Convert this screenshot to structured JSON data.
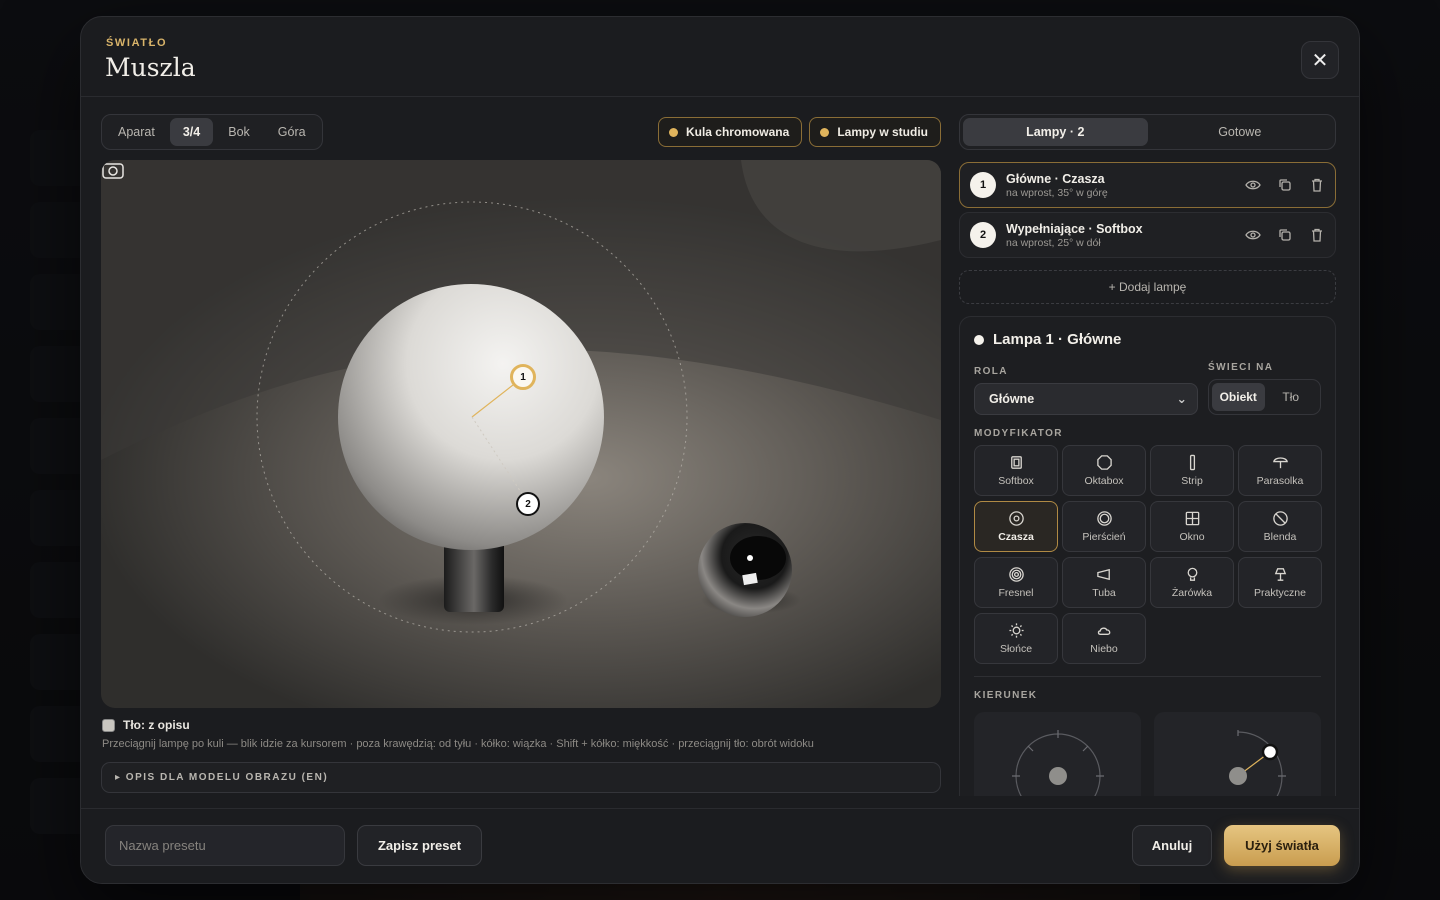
{
  "colors": {
    "accent": "#e0b45c",
    "accent_border": "#8a6d36",
    "panel": "#1b1c1f"
  },
  "modal": {
    "eyebrow": "ŚWIATŁO",
    "title": "Muszla",
    "close_icon": "close-icon"
  },
  "view": {
    "tabs": [
      "Aparat",
      "3/4",
      "Bok",
      "Góra"
    ],
    "active_tab": "3/4",
    "chips": [
      "Kula chromowana",
      "Lampy w studiu"
    ],
    "markers": [
      "1",
      "2"
    ],
    "background_checkbox": "Tło: z opisu",
    "hint": "Przeciągnij lampę po kuli — blik idzie za kursorem · poza krawędzią: od tyłu · kółko: wiązka · Shift + kółko: miękkość · przeciągnij tło: obrót widoku",
    "description_toggle": "▸ OPIS DLA MODELU OBRAZU (EN)"
  },
  "lamps": {
    "tabs": [
      "Lampy · 2",
      "Gotowe"
    ],
    "list": [
      {
        "num": "1",
        "name": "Główne · Czasza",
        "sub": "na wprost, 35° w górę",
        "selected": true
      },
      {
        "num": "2",
        "name": "Wypełniające · Softbox",
        "sub": "na wprost, 25° w dół",
        "selected": false
      }
    ],
    "add_label": "+ Dodaj lampę"
  },
  "editor": {
    "title": "Lampa 1 · Główne",
    "role_label": "ROLA",
    "role_value": "Główne",
    "shine_label": "ŚWIECI NA",
    "shine_options": [
      "Obiekt",
      "Tło"
    ],
    "shine_selected": "Obiekt",
    "modifier_label": "MODYFIKATOR",
    "modifiers": [
      {
        "label": "Softbox",
        "icon": "softbox-icon"
      },
      {
        "label": "Oktabox",
        "icon": "octabox-icon"
      },
      {
        "label": "Strip",
        "icon": "strip-icon"
      },
      {
        "label": "Parasolka",
        "icon": "umbrella-icon"
      },
      {
        "label": "Czasza",
        "icon": "beauty-dish-icon"
      },
      {
        "label": "Pierścień",
        "icon": "ring-light-icon"
      },
      {
        "label": "Okno",
        "icon": "window-icon"
      },
      {
        "label": "Blenda",
        "icon": "flag-icon"
      },
      {
        "label": "Fresnel",
        "icon": "fresnel-icon"
      },
      {
        "label": "Tuba",
        "icon": "snoot-icon"
      },
      {
        "label": "Żarówka",
        "icon": "bulb-icon"
      },
      {
        "label": "Praktyczne",
        "icon": "practical-lamp-icon"
      },
      {
        "label": "Słońce",
        "icon": "sun-icon"
      },
      {
        "label": "Niebo",
        "icon": "cloud-icon"
      }
    ],
    "modifier_selected": "Czasza",
    "direction_label": "KIERUNEK"
  },
  "footer": {
    "preset_placeholder": "Nazwa presetu",
    "save_label": "Zapisz preset",
    "cancel_label": "Anuluj",
    "apply_label": "Użyj światła"
  }
}
